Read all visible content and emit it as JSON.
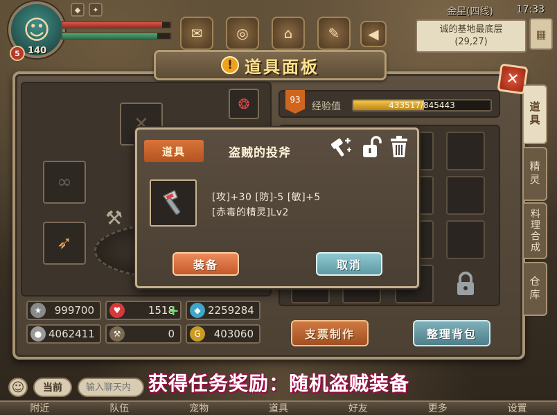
{
  "hud": {
    "level": "140",
    "level_badge": "5",
    "server": "金星(四线)",
    "time": "17:33",
    "location_name": "诚的基地最底层",
    "location_coords": "(29,27)"
  },
  "panel": {
    "title": "道具面板",
    "side_tabs": [
      "道具",
      "精灵",
      "料理合成",
      "仓库"
    ]
  },
  "stats": {
    "attack_score": "999700",
    "hearts": "1518",
    "diamonds": "2259284",
    "silver": "4062411",
    "hammer": "0",
    "gold": "403060"
  },
  "experience": {
    "level": "93",
    "label": "经验值",
    "text": "433517/845443",
    "fraction": 0.513
  },
  "buttons": {
    "cheque": "支票制作",
    "tidy": "整理背包"
  },
  "dialog": {
    "tab": "道具",
    "item_name": "盗贼的投斧",
    "stats_line1": "[攻]+30 [防]-5 [敏]+5",
    "stats_line2": "[赤毒的精灵]Lv2",
    "equip": "装备",
    "cancel": "取消"
  },
  "chat": {
    "channel": "当前",
    "placeholder": "输入聊天内"
  },
  "banner": "获得任务奖励：随机盗贼装备",
  "nav": [
    "附近",
    "队伍",
    "宠物",
    "道具",
    "好友",
    "更多",
    "设置"
  ]
}
